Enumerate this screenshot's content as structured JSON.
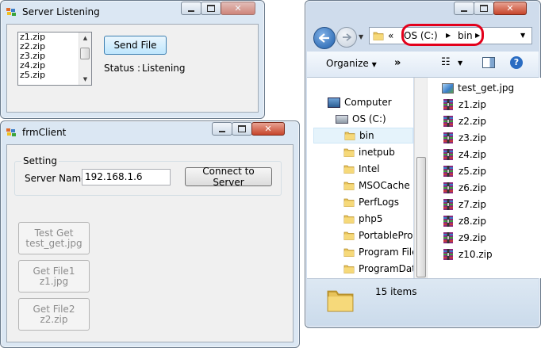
{
  "server": {
    "title": "Server Listening",
    "files": [
      "z1.zip",
      "z2.zip",
      "z3.zip",
      "z4.zip",
      "z5.zip"
    ],
    "send_label": "Send File",
    "status_label": "Status :",
    "status_value": "Listening"
  },
  "client": {
    "title": "frmClient",
    "group_title": "Setting",
    "server_name_label": "Server Name:",
    "server_name_value": "192.168.1.6",
    "connect_label": "Connect to Server",
    "test_get": [
      "Test Get",
      "test_get.jpg"
    ],
    "get_file1": [
      "Get File1",
      "z1.jpg"
    ],
    "get_file2": [
      "Get File2",
      "z2.zip"
    ]
  },
  "explorer": {
    "address": {
      "prefix": "«",
      "segments": [
        "OS (C:)",
        "bin"
      ]
    },
    "toolbar": {
      "organize": "Organize",
      "more": "»"
    },
    "tree": {
      "computer": "Computer",
      "drive": "OS (C:)",
      "folders": [
        "bin",
        "inetpub",
        "Intel",
        "MSOCache",
        "PerfLogs",
        "php5",
        "PortableProg",
        "Program Files",
        "ProgramData"
      ]
    },
    "files": [
      "test_get.jpg",
      "z1.zip",
      "z2.zip",
      "z3.zip",
      "z4.zip",
      "z5.zip",
      "z6.zip",
      "z7.zip",
      "z8.zip",
      "z9.zip",
      "z10.zip"
    ],
    "status": "15 items",
    "colors": {
      "highlight": "#e3001b",
      "selection": "#e5f3fb"
    }
  }
}
